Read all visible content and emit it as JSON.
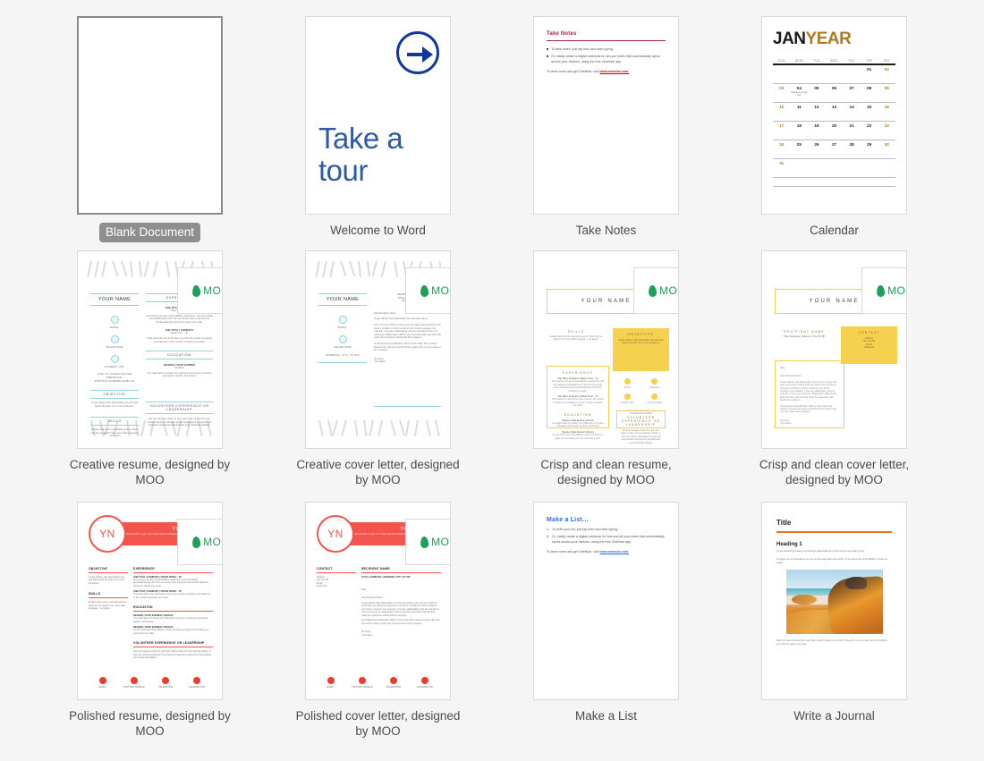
{
  "gallery": {
    "background_color": "#f5f5f5",
    "selected_item": "Blank Document",
    "items": [
      {
        "caption": "Blank Document",
        "selected": true
      },
      {
        "caption": "Welcome to Word",
        "selected": false
      },
      {
        "caption": "Take Notes",
        "selected": false
      },
      {
        "caption": "Calendar",
        "selected": false
      },
      {
        "caption": "Creative resume, designed by MOO",
        "selected": false
      },
      {
        "caption": "Creative cover letter, designed by MOO",
        "selected": false
      },
      {
        "caption": "Crisp and clean resume, designed by MOO",
        "selected": false
      },
      {
        "caption": "Crisp and clean cover letter, designed by MOO",
        "selected": false
      },
      {
        "caption": "Polished resume, designed by MOO",
        "selected": false
      },
      {
        "caption": "Polished cover letter, designed by MOO",
        "selected": false
      },
      {
        "caption": "Make a List",
        "selected": false
      },
      {
        "caption": "Write a Journal",
        "selected": false
      }
    ]
  },
  "tour": {
    "line1": "Take a",
    "line2": "tour",
    "accent_color": "#2e5aa8",
    "arrow_color": "#10399b"
  },
  "take_notes": {
    "title": "Take Notes",
    "accent_color": "#9e2a4a",
    "link_color": "#c00000",
    "bullets": [
      "To take notes, just tap here and start typing.",
      "Or, easily create a digital notebook for all your notes that automatically syncs across your devices, using the free OneNote app."
    ],
    "footer_prefix": "To learn more and get OneNote, visit ",
    "footer_link": "www.onenote.com."
  },
  "make_a_list": {
    "title": "Make a List…",
    "accent_color": "#2b6fd4",
    "link_color": "#2b6fd4",
    "items": [
      "To write your list, just tap here and start typing.",
      "Or, easily create a digital notebook for lists and all your notes that automatically syncs across your devices, using the free OneNote app."
    ],
    "footer_prefix": "To learn more and get OneNote, visit ",
    "footer_link": "www.onenote.com."
  },
  "calendar": {
    "title_month": "JAN",
    "title_year": "YEAR",
    "month_color": "#1a1a1a",
    "year_color": "#b07a24",
    "day_headers": [
      "SUN",
      "MON",
      "TUE",
      "WED",
      "THU",
      "FRI",
      "SAT"
    ],
    "weeks": [
      [
        "",
        "",
        "",
        "",
        "",
        "01",
        "02"
      ],
      [
        "03",
        "04",
        "05",
        "06",
        "07",
        "08",
        "09"
      ],
      [
        "10",
        "11",
        "12",
        "13",
        "14",
        "15",
        "16"
      ],
      [
        "17",
        "18",
        "19",
        "20",
        "21",
        "22",
        "23"
      ],
      [
        "24",
        "25",
        "26",
        "27",
        "28",
        "29",
        "30"
      ],
      [
        "31",
        "",
        "",
        "",
        "",
        "",
        ""
      ]
    ],
    "event_note": "Click here to type text"
  },
  "moo": {
    "brand": "MOO",
    "brand_color": "#1ea05a",
    "leaf_icon": "moo-leaf-icon"
  },
  "creative": {
    "accent_color": "#8fd3dd",
    "name": "YOUR NAME",
    "contact_labels": [
      "EMAIL",
      "TELEPHONE",
      "LINKEDIN URL",
      "LINK TO OTHER ONLINE PRESENCE: PORTFOLIO/WEBSITE/BLOG"
    ],
    "resume": {
      "sections": [
        "EXPERIENCE",
        "EDUCATION",
        "VOLUNTEER EXPERIENCE OR LEADERSHIP",
        "OBJECTIVE",
        "SKILLS"
      ],
      "job_heading": "JOB TITLE | COMPANY",
      "job_dates": "Dates From – To",
      "job_body_1": "Summarize your key responsibilities, leadership, and most stellar accomplishments. Don't be too wordy; keep it relevant and include data that shows the impact you made.",
      "job_body_2": "Think about the size of the team you led, the number of projects you balanced, or the number of articles you wrote.",
      "edu_heading": "DEGREE | DATE EARNED",
      "edu_sub": "SCHOOL",
      "edu_body": "You might want to include your GPA and a summary of relevant coursework, awards, and honors.",
      "objective_body": "To get started, click placeholder text and start typing. Be brief: one or two sentences.",
      "skills_body": "Explain what you're especially good at. What role are you apply? Use cover skills: language – not jargon.",
      "volunteer_body": "Did you manage a team for your club, lead a project for your favorite charity, or edit your school newspaper? Go ahead and describe experiences that illustrate your leadership abilities."
    },
    "cover_letter": {
      "recipient": "RECIPIENT NAME\nTITLE | COMPANY\nADDRESS",
      "salutation": "Dear Recipient Name,",
      "body_1": "To get started, click placeholder text and start typing.",
      "body_2": "Use your cover letter to show how your talent and experience will solve a problem or drive results for your future employer. For example, if you are collaborative, give an example of how you used your collaboration skills at your last internship, and how that made the experience will benefit the employer.",
      "body_3": "It's all about personalization. Write a cover letter that uniquely presents the real you and the future impact only you can make at the company.",
      "closing": "Sincerely,",
      "signature": "Your Name",
      "contact_line": "ADDRESS, CITY, ST ZIP"
    }
  },
  "crisp": {
    "accent_color": "#f5d14f",
    "border_color": "#f3cf4a",
    "name": "YOUR NAME",
    "resume": {
      "sections": [
        "SKILLS",
        "OBJECTIVE",
        "EXPERIENCE",
        "EDUCATION",
        "VOLUNTEER EXPERIENCE OR LEADERSHIP"
      ],
      "skills_body": "Explain what you're especially good at. What will you apply? Use cover skills language – not jargon.",
      "objective_body": "To get started, click placeholder text and start typing. Be brief: one or two sentences.",
      "job_heading": "Job Title  |  Company  |  Dates From – To",
      "job_body_1": "Summarize your key responsibilities, leadership, and most stellar accomplishments. Don't be too wordy; keep it relevant and include data that shows the impact you made.",
      "job_body_2": "Think about the size of the team you led, the number of projects you balanced, or the number of articles you wrote.",
      "edu_heading": "Degree  |  Date Earned  |  School",
      "edu_body_1": "You might want to include your GPA and a summary of relevant coursework, awards, and honors.",
      "edu_body_2": "On the Home tab of the Ribbon, check out Styles to apply the formatting you need with just a click.",
      "volunteer_body": "Did you manage a team for your club, lead a project for your favorite charity, or edit your school newspaper? Go ahead and describe experiences that illustrate your leadership abilities.",
      "contact_labels": [
        "Email",
        "Telephone",
        "LinkedIn URL",
        "Further handle"
      ],
      "contact_footer": "Link to other online presence: Portfolio/Website/Blog"
    },
    "cover_letter": {
      "recipient_name": "RECIPIENT NAME",
      "recipient_meta": "Title  |  Company  |  Address  |  City, ST ZIP",
      "contact_head": "CONTACT",
      "contact_items": [
        "Address",
        "City, ST ZIP",
        "Email",
        "Telephone"
      ],
      "date": "Date",
      "salutation": "Dear Recipient Name,",
      "body_1": "To get started, click placeholder text and start typing. Use your cover letter to show how your talent and experience will solve a problem or drive results for your future employer. For example, if you are collaborative, give an example of how you used your collaboration skills at your last internship, and how that made the experience will benefit the employer.",
      "body_2": "It's all about personalization. Write a cover letter that uniquely presents the real you and the future impact only you can make at the company.",
      "closing": "Sincerely,",
      "signature": "Your Name"
    }
  },
  "polished": {
    "accent_color": "#f4544b",
    "icon_color": "#ee3b30",
    "monogram": "YN",
    "banner_name": "YOUR NAME",
    "banner_sub": "PROFESSION OR INDUSTRY | LINK TO OTHER ONLINE PRESENCE: PORTFOLIO/WEBSITE/BLOG",
    "resume": {
      "sections": [
        "OBJECTIVE",
        "SKILLS",
        "EXPERIENCE",
        "EDUCATION",
        "VOLUNTEER EXPERIENCE OR LEADERSHIP"
      ],
      "objective_body": "To get started, click placeholder text and start typing. Be brief: one or two sentences.",
      "skills_body": "Explain what you're especially good at. What are you apply? Use cover skills language – not jargon.",
      "job_heading": "JOB TITLE  |  COMPANY  |  DATES FROM – TO",
      "job_body_1": "Summarize your key responsibilities, leadership, and most stellar accomplishments. Don't be too wordy; keep it relevant and include data that shows the impact you made.",
      "job_body_2": "Think about the size of the team you led, the number of projects you balanced, or the number of articles you wrote.",
      "edu_heading": "DEGREE  |  DATE EARNED  |  SCHOOL",
      "edu_body_1": "You might want to include your GPA and a summary of relevant coursework, awards, and honors.",
      "edu_body_2": "On the Home tab of the Ribbon, check out Styles to apply the formatting you need with just a click.",
      "volunteer_body": "Did you manage a team for your club, lead a project for your favorite charity, or edit your school newspaper? Go ahead and describe experiences that illustrate your leadership abilities."
    },
    "cover_letter": {
      "contact_head": "CONTACT",
      "contact_items": [
        "Address",
        "City, ST ZIP",
        "Email",
        "Telephone"
      ],
      "recipient_head": "RECIPIENT NAME",
      "recipient_meta": "TITLE  |  COMPANY  |  ADDRESS  |  CITY, ST ZIP",
      "date": "Date",
      "salutation": "Dear Recipient Name,",
      "body_1": "To get started, click placeholder text and start typing. Use your cover letter to show how your talent and experience will solve a problem or drive results for your future employer. For example, if you are collaborative, give an example of how you used your collaboration skills at your last internship, and how that made the experience will benefit the employer.",
      "body_2": "It's all about personalization. Write a cover letter that uniquely presents the real you and the future impact only you can make at the company.",
      "closing": "Sincerely,",
      "signature": "Your Name"
    },
    "footer_icons": [
      {
        "label": "EMAIL",
        "icon": "email-icon"
      },
      {
        "label": "TWITTER HANDLE",
        "icon": "twitter-icon"
      },
      {
        "label": "TELEPHONE",
        "icon": "telephone-icon"
      },
      {
        "label": "LINKEDIN URL",
        "icon": "linkedin-icon"
      }
    ]
  },
  "journal": {
    "title": "Title",
    "rule_color": "#e8711a",
    "heading": "Heading 1",
    "body_1": "To get started right away, just click any placeholder text (such as this) and start typing.",
    "body_2": "To apply any text formatting you see on this page with just a click, on the Home tab of the Ribbon, check out Styles.",
    "body_3": "Want to insert a picture from your files or add a shape or text box? You got it! On the Insert tab of the Ribbon, just click the option you need.",
    "photo_alt": "coastal-rocks-photo"
  }
}
